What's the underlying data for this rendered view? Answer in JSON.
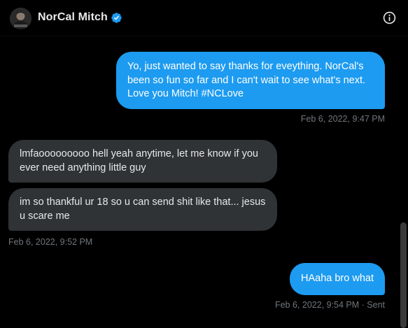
{
  "header": {
    "name": "NorCal Mitch",
    "verified": true,
    "info_icon": "info-icon",
    "avatar_icon": "user-avatar"
  },
  "colors": {
    "background": "#000000",
    "sent_bubble": "#1d9bf0",
    "received_bubble": "#2f3336",
    "meta_text": "#71767b",
    "verified_badge": "#1d9bf0"
  },
  "messages": [
    {
      "direction": "sent",
      "text": "Yo, just wanted to say thanks for eveything. NorCal's been so fun so far and I can't wait to see what's next. Love you Mitch! #NCLove"
    },
    {
      "direction": "received",
      "text": "lmfaooooooooo hell yeah anytime, let me know if you ever need anything little guy"
    },
    {
      "direction": "received",
      "text": "im so thankful ur 18 so u can send shit like that... jesus u scare me"
    },
    {
      "direction": "sent",
      "text": "HAaha bro what"
    }
  ],
  "timestamps": {
    "first": "Feb 6, 2022, 9:47 PM",
    "second": "Feb 6, 2022, 9:52 PM",
    "third": "Feb 6, 2022, 9:54 PM · Sent"
  }
}
